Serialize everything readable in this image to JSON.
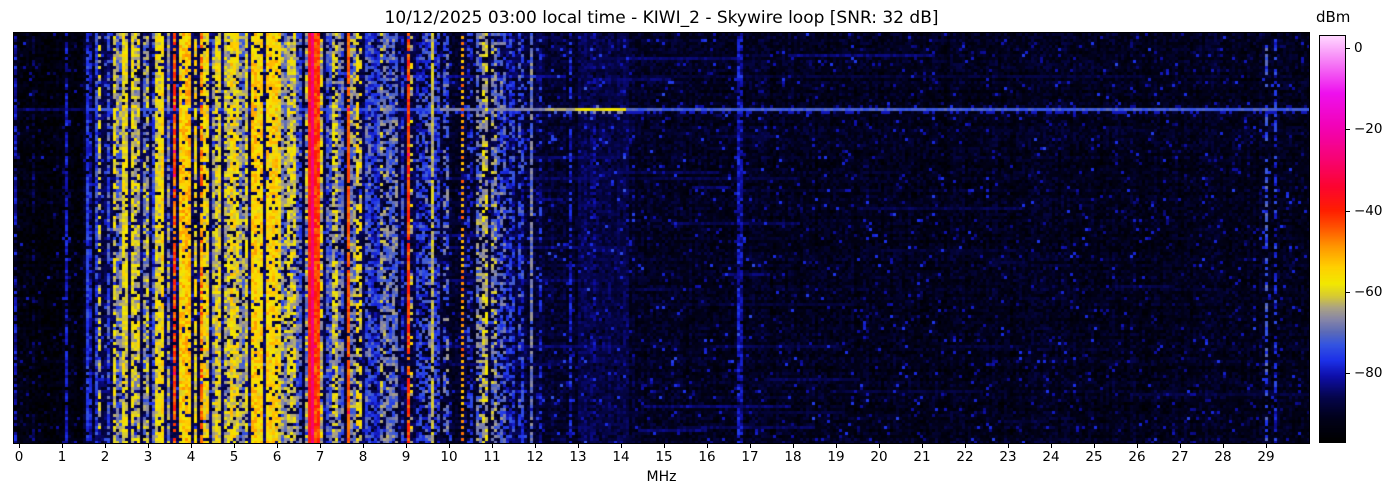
{
  "chart_data": {
    "type": "heatmap",
    "subtype": "hf-radio-spectrogram-waterfall",
    "title": "10/12/2025 03:00 local time - KIWI_2 - Skywire loop [SNR: 32 dB]",
    "xlabel": "MHz",
    "x_range_mhz": [
      -0.13,
      30.0
    ],
    "x_ticks": [
      0,
      1,
      2,
      3,
      4,
      5,
      6,
      7,
      8,
      9,
      10,
      11,
      12,
      13,
      14,
      15,
      16,
      17,
      18,
      19,
      20,
      21,
      22,
      23,
      24,
      25,
      26,
      27,
      28,
      29
    ],
    "grid": false,
    "colorbar": {
      "label": "dBm",
      "tick_values": [
        0,
        -20,
        -40,
        -60,
        -80
      ],
      "tick_labels": [
        "0",
        "−20",
        "−40",
        "−60",
        "−80"
      ],
      "value_range_dbm": [
        3,
        -97
      ],
      "colormap_stops": [
        [
          -97,
          "#000000"
        ],
        [
          -91,
          "#01011c"
        ],
        [
          -86,
          "#05054d"
        ],
        [
          -81,
          "#0e0ea8"
        ],
        [
          -77,
          "#1c30e8"
        ],
        [
          -73,
          "#3555e0"
        ],
        [
          -70,
          "#5b6ab8"
        ],
        [
          -67,
          "#8585a8"
        ],
        [
          -64,
          "#aaa284"
        ],
        [
          -61,
          "#d8cc30"
        ],
        [
          -58,
          "#f2e800"
        ],
        [
          -54,
          "#ffd000"
        ],
        [
          -49,
          "#ff9800"
        ],
        [
          -44,
          "#ff5000"
        ],
        [
          -40,
          "#ff1e00"
        ],
        [
          -34,
          "#fc0430"
        ],
        [
          -27,
          "#f70376"
        ],
        [
          -19,
          "#f202b8"
        ],
        [
          -11,
          "#ee10ee"
        ],
        [
          -4,
          "#f573f5"
        ],
        [
          3,
          "#ffd6ff"
        ]
      ]
    },
    "noise_floor_regions": [
      [
        -0.2,
        1.5,
        -94
      ],
      [
        1.5,
        1.8,
        -90
      ],
      [
        1.8,
        6.5,
        -86.5
      ],
      [
        6.5,
        9.2,
        -87.5
      ],
      [
        9.2,
        10.6,
        -89.5
      ],
      [
        10.6,
        12.3,
        -88.5
      ],
      [
        12.3,
        14.5,
        -89.5
      ],
      [
        14.5,
        17.5,
        -91
      ],
      [
        17.5,
        30.0,
        -91.5
      ]
    ],
    "bands_format": [
      "f0_mhz",
      "f1_mhz",
      "level_dbm",
      "jitter_db",
      "coverage",
      "style"
    ],
    "signal_bands": [
      [
        -0.13,
        -0.03,
        -80,
        5,
        0.7
      ],
      [
        0.3,
        0.35,
        -87,
        4,
        0.5
      ],
      [
        1.1,
        1.16,
        -79,
        4,
        0.85
      ],
      [
        1.4,
        1.45,
        -84,
        5,
        0.6
      ],
      [
        1.56,
        1.63,
        -77,
        4,
        0.9
      ],
      [
        1.66,
        1.72,
        -80,
        5,
        0.7
      ],
      [
        1.78,
        1.85,
        -74,
        5,
        0.8
      ],
      [
        1.86,
        1.93,
        -62,
        5,
        0.55,
        "dotted"
      ],
      [
        2.06,
        2.14,
        -72,
        6,
        0.7
      ],
      [
        2.16,
        2.26,
        -61,
        5,
        0.7
      ],
      [
        2.28,
        2.38,
        -68,
        8,
        0.8
      ],
      [
        2.4,
        2.54,
        -59,
        5,
        0.85
      ],
      [
        2.57,
        2.68,
        -58,
        5,
        0.85
      ],
      [
        2.7,
        2.84,
        -62,
        7,
        0.8
      ],
      [
        2.87,
        3.03,
        -66,
        8,
        0.8
      ],
      [
        3.06,
        3.15,
        -72,
        7,
        0.7
      ],
      [
        3.17,
        3.37,
        -58,
        5,
        0.85
      ],
      [
        3.41,
        3.53,
        -67,
        7,
        0.8
      ],
      [
        3.57,
        3.67,
        -44,
        6,
        0.85
      ],
      [
        3.69,
        3.83,
        -55,
        6,
        0.9
      ],
      [
        3.85,
        4.03,
        -52,
        5,
        0.9
      ],
      [
        4.05,
        4.17,
        -58,
        6,
        0.85
      ],
      [
        4.21,
        4.27,
        -48,
        7,
        0.8
      ],
      [
        4.29,
        4.45,
        -57,
        6,
        0.85
      ],
      [
        4.47,
        4.57,
        -66,
        7,
        0.8
      ],
      [
        4.59,
        4.73,
        -59,
        6,
        0.85
      ],
      [
        4.75,
        4.89,
        -63,
        7,
        0.8
      ],
      [
        4.91,
        5.09,
        -58,
        6,
        0.85
      ],
      [
        5.11,
        5.23,
        -68,
        7,
        0.75
      ],
      [
        5.25,
        5.35,
        -60,
        5,
        0.85
      ],
      [
        5.37,
        5.67,
        -55,
        5,
        0.9
      ],
      [
        5.71,
        5.93,
        -56,
        5,
        0.9
      ],
      [
        5.95,
        6.09,
        -57,
        6,
        0.85
      ],
      [
        6.11,
        6.23,
        -66,
        7,
        0.8
      ],
      [
        6.25,
        6.43,
        -61,
        6,
        0.8
      ],
      [
        6.47,
        6.61,
        -72,
        7,
        0.75
      ],
      [
        6.63,
        6.72,
        -64,
        7,
        0.8
      ],
      [
        6.73,
        6.79,
        -38,
        4,
        1
      ],
      [
        6.8,
        6.83,
        -28,
        3,
        1
      ],
      [
        6.84,
        6.99,
        -42,
        5,
        1
      ],
      [
        7.02,
        7.1,
        -62,
        8,
        0.8
      ],
      [
        7.12,
        7.26,
        -73,
        7,
        0.8
      ],
      [
        7.28,
        7.4,
        -62,
        6,
        0.75
      ],
      [
        7.42,
        7.55,
        -70,
        7,
        0.7
      ],
      [
        7.63,
        7.67,
        -45,
        3,
        0.95
      ],
      [
        7.7,
        7.84,
        -68,
        7,
        0.75
      ],
      [
        7.86,
        7.98,
        -59,
        6,
        0.6,
        "dotted"
      ],
      [
        8.02,
        8.18,
        -72,
        7,
        0.8
      ],
      [
        8.2,
        8.38,
        -76,
        6,
        0.7
      ],
      [
        8.42,
        8.52,
        -68,
        7,
        0.6
      ],
      [
        8.55,
        8.8,
        -70,
        6,
        0.7
      ],
      [
        8.85,
        8.98,
        -74,
        7,
        0.6
      ],
      [
        9.01,
        9.07,
        -42,
        5,
        0.95
      ],
      [
        9.08,
        9.16,
        -60,
        7,
        0.4,
        "dotted"
      ],
      [
        9.25,
        9.42,
        -77,
        6,
        0.6
      ],
      [
        9.45,
        9.56,
        -72,
        7,
        0.6
      ],
      [
        9.59,
        9.63,
        -61,
        3,
        0.95
      ],
      [
        9.66,
        9.82,
        -76,
        6,
        0.6
      ],
      [
        9.86,
        9.98,
        -72,
        7,
        0.5
      ],
      [
        10.28,
        10.34,
        -50,
        5,
        0.6,
        "dashed"
      ],
      [
        10.42,
        10.56,
        -77,
        6,
        0.5
      ],
      [
        10.62,
        10.76,
        -69,
        7,
        0.6
      ],
      [
        10.8,
        10.94,
        -63,
        6,
        0.7
      ],
      [
        10.97,
        11.1,
        -66,
        7,
        0.65
      ],
      [
        11.14,
        11.3,
        -73,
        7,
        0.6
      ],
      [
        11.35,
        11.5,
        -78,
        6,
        0.5
      ],
      [
        11.58,
        11.74,
        -75,
        6,
        0.55
      ],
      [
        11.86,
        11.93,
        -68,
        5,
        0.9
      ],
      [
        12.06,
        12.18,
        -80,
        6,
        0.5
      ],
      [
        12.8,
        12.86,
        -80,
        5,
        0.75
      ],
      [
        13.0,
        14.2,
        -87,
        3,
        0.9
      ],
      [
        13.35,
        13.45,
        -84,
        4,
        0.7
      ],
      [
        16.7,
        16.84,
        -81,
        4,
        0.85
      ],
      [
        28.97,
        29.05,
        -73,
        5,
        0.5,
        "dotted"
      ],
      [
        29.19,
        29.26,
        -77,
        5,
        0.55,
        "dotted"
      ]
    ],
    "event_row": {
      "y_frac": 0.188,
      "segments": [
        [
          -0.2,
          1.6,
          -85
        ],
        [
          1.6,
          9.8,
          -74
        ],
        [
          9.8,
          12.2,
          -68
        ],
        [
          12.2,
          12.9,
          -64
        ],
        [
          12.9,
          14.1,
          -59
        ],
        [
          14.1,
          30.0,
          -72
        ]
      ]
    },
    "faint_streaks": [
      [
        0.105,
        7.6,
        12.6,
        -83
      ],
      [
        0.1,
        14.5,
        26.0,
        -88
      ],
      [
        0.35,
        9.0,
        13.5,
        -85
      ],
      [
        0.52,
        10.0,
        14.0,
        -85
      ],
      [
        0.6,
        9.5,
        13.0,
        -85
      ],
      [
        0.76,
        9.8,
        13.8,
        -84
      ],
      [
        0.8,
        10.0,
        12.5,
        -85
      ]
    ]
  }
}
